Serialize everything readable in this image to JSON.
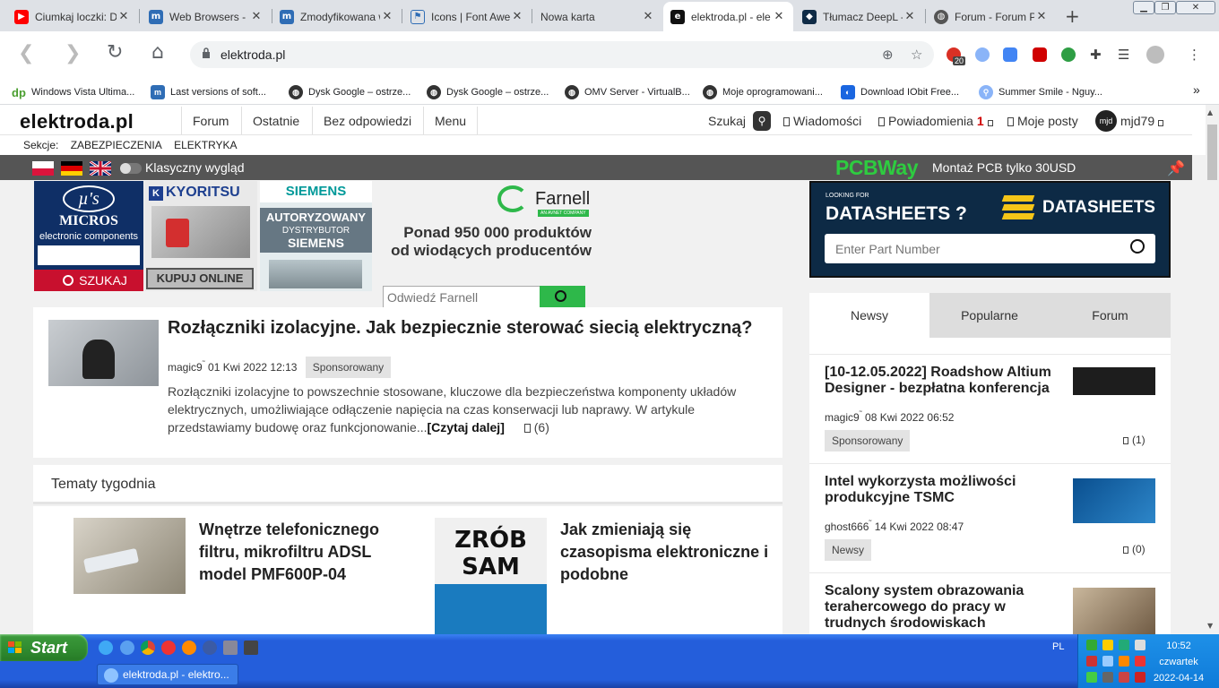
{
  "tabs": [
    {
      "title": "Ciumkaj loczki: DU",
      "icon": "youtube-icon",
      "color": "#ff0000"
    },
    {
      "title": "Web Browsers - M",
      "icon": "mt-icon",
      "color": "#2f6db5"
    },
    {
      "title": "Zmodyfikowana w",
      "icon": "mt-icon",
      "color": "#2f6db5"
    },
    {
      "title": "Icons | Font Awe",
      "icon": "flag-icon",
      "color": "#2f6db5"
    },
    {
      "title": "Nowa karta",
      "icon": "",
      "color": ""
    },
    {
      "title": "elektroda.pl - ele",
      "icon": "elektroda-icon",
      "color": "#111111"
    },
    {
      "title": "Tłumacz DeepL -",
      "icon": "deepl-icon",
      "color": "#0f2b46"
    },
    {
      "title": "Forum - Forum PC",
      "icon": "globe-icon",
      "color": "#555555"
    }
  ],
  "omnibox": {
    "url": "elektroda.pl"
  },
  "bookmarks": [
    {
      "label": "Windows Vista Ultima...",
      "icon": "dp-icon"
    },
    {
      "label": "Last versions of soft...",
      "icon": "mt-icon"
    },
    {
      "label": "Dysk Google – ostrze...",
      "icon": "globe-icon"
    },
    {
      "label": "Dysk Google – ostrze...",
      "icon": "globe-icon"
    },
    {
      "label": "OMV Server - VirtualB...",
      "icon": "globe-icon"
    },
    {
      "label": "Moje oprogramowani...",
      "icon": "globe-icon"
    },
    {
      "label": "Download IObit Free...",
      "icon": "iobit-icon"
    },
    {
      "label": "Summer Smile - Nguy...",
      "icon": "search-icon"
    }
  ],
  "ext_badge": "20",
  "bookmarks_more": "»",
  "site": {
    "logo": "elektroda.pl",
    "menu": [
      "Forum",
      "Ostatnie",
      "Bez odpowiedzi",
      "Menu"
    ],
    "search_label": "Szukaj",
    "messages": "Wiadomości",
    "notifications": "Powiadomienia",
    "notifications_count": "1",
    "my_posts": "Moje posty",
    "avatar_initials": "mjd",
    "username": "mjd79",
    "sections_label": "Sekcje:",
    "sections": [
      "ZABEZPIECZENIA",
      "ELEKTRYKA"
    ],
    "classic_view": "Klasyczny wygląd",
    "pcbway_logo": "PCBWay",
    "pcbway_text": "Montaż PCB tylko 30USD"
  },
  "ads": {
    "micros_symbol": "µ's",
    "micros_name": "MICROS",
    "micros_sub": "electronic components",
    "micros_btn": "SZUKAJ",
    "kyoritsu_name": "KYORITSU",
    "kyoritsu_btn": "KUPUJ ONLINE",
    "siemens_name": "SIEMENS",
    "siemens_l1": "AUTORYZOWANY",
    "siemens_l2": "DYSTRYBUTOR",
    "siemens_l3": "SIEMENS",
    "farnell_name": "Farnell",
    "farnell_tag": "AN AVNET COMPANY",
    "farnell_text": "Ponad 950 000 produktów od wiodących producentów",
    "farnell_placeholder": "Odwiedź Farnell",
    "ds_looking": "LOOKING FOR",
    "ds_title": "DATASHEETS ?",
    "ds_brand": "DATASHEETS",
    "ds_placeholder": "Enter Part Number"
  },
  "featured": {
    "title": "Rozłączniki izolacyjne. Jak bezpiecznie sterować siecią elektryczną?",
    "author": "magic9",
    "date": "01 Kwi 2022 12:13",
    "badge": "Sponsorowany",
    "desc": "Rozłączniki izolacyjne to powszechnie stosowane, kluczowe dla bezpieczeństwa komponenty układów elektrycznych, umożliwiające odłączenie napięcia na czas konserwacji lub naprawy. W artykule przedstawiamy budowę oraz funkcjonowanie...",
    "read_more": "[Czytaj dalej]",
    "comments": "(6)"
  },
  "tematy": {
    "heading": "Tematy tygodnia",
    "items": [
      {
        "title": "Wnętrze telefonicznego filtru, mikrofiltru ADSL model PMF600P-04"
      },
      {
        "title": "Jak zmieniają się czasopisma elektroniczne i podobne"
      }
    ],
    "cover_text": "ZRÓB SAM"
  },
  "side_tabs": [
    "Newsy",
    "Popularne",
    "Forum"
  ],
  "news": [
    {
      "title": "[10-12.05.2022] Roadshow Altium Designer - bezpłatna konferencja",
      "author": "magic9",
      "date": "08 Kwi 2022 06:52",
      "badge": "Sponsorowany",
      "comments": "(1)"
    },
    {
      "title": "Intel wykorzysta możliwości produkcyjne TSMC",
      "author": "ghost666",
      "date": "14 Kwi 2022 08:47",
      "badge": "Newsy",
      "comments": "(0)"
    },
    {
      "title": "Scalony system obrazowania terahercowego do pracy w trudnych środowiskach",
      "author": "",
      "date": "",
      "badge": "",
      "comments": ""
    }
  ],
  "taskbar": {
    "start": "Start",
    "task": "elektroda.pl - elektro...",
    "lang": "PL",
    "time": "10:52",
    "day": "czwartek",
    "date": "2022-04-14"
  },
  "colors": {
    "accent_green": "#2ecc40",
    "farnell_green": "#2eb84a",
    "badge_red": "#d00000",
    "xp_blue": "#245edb"
  }
}
